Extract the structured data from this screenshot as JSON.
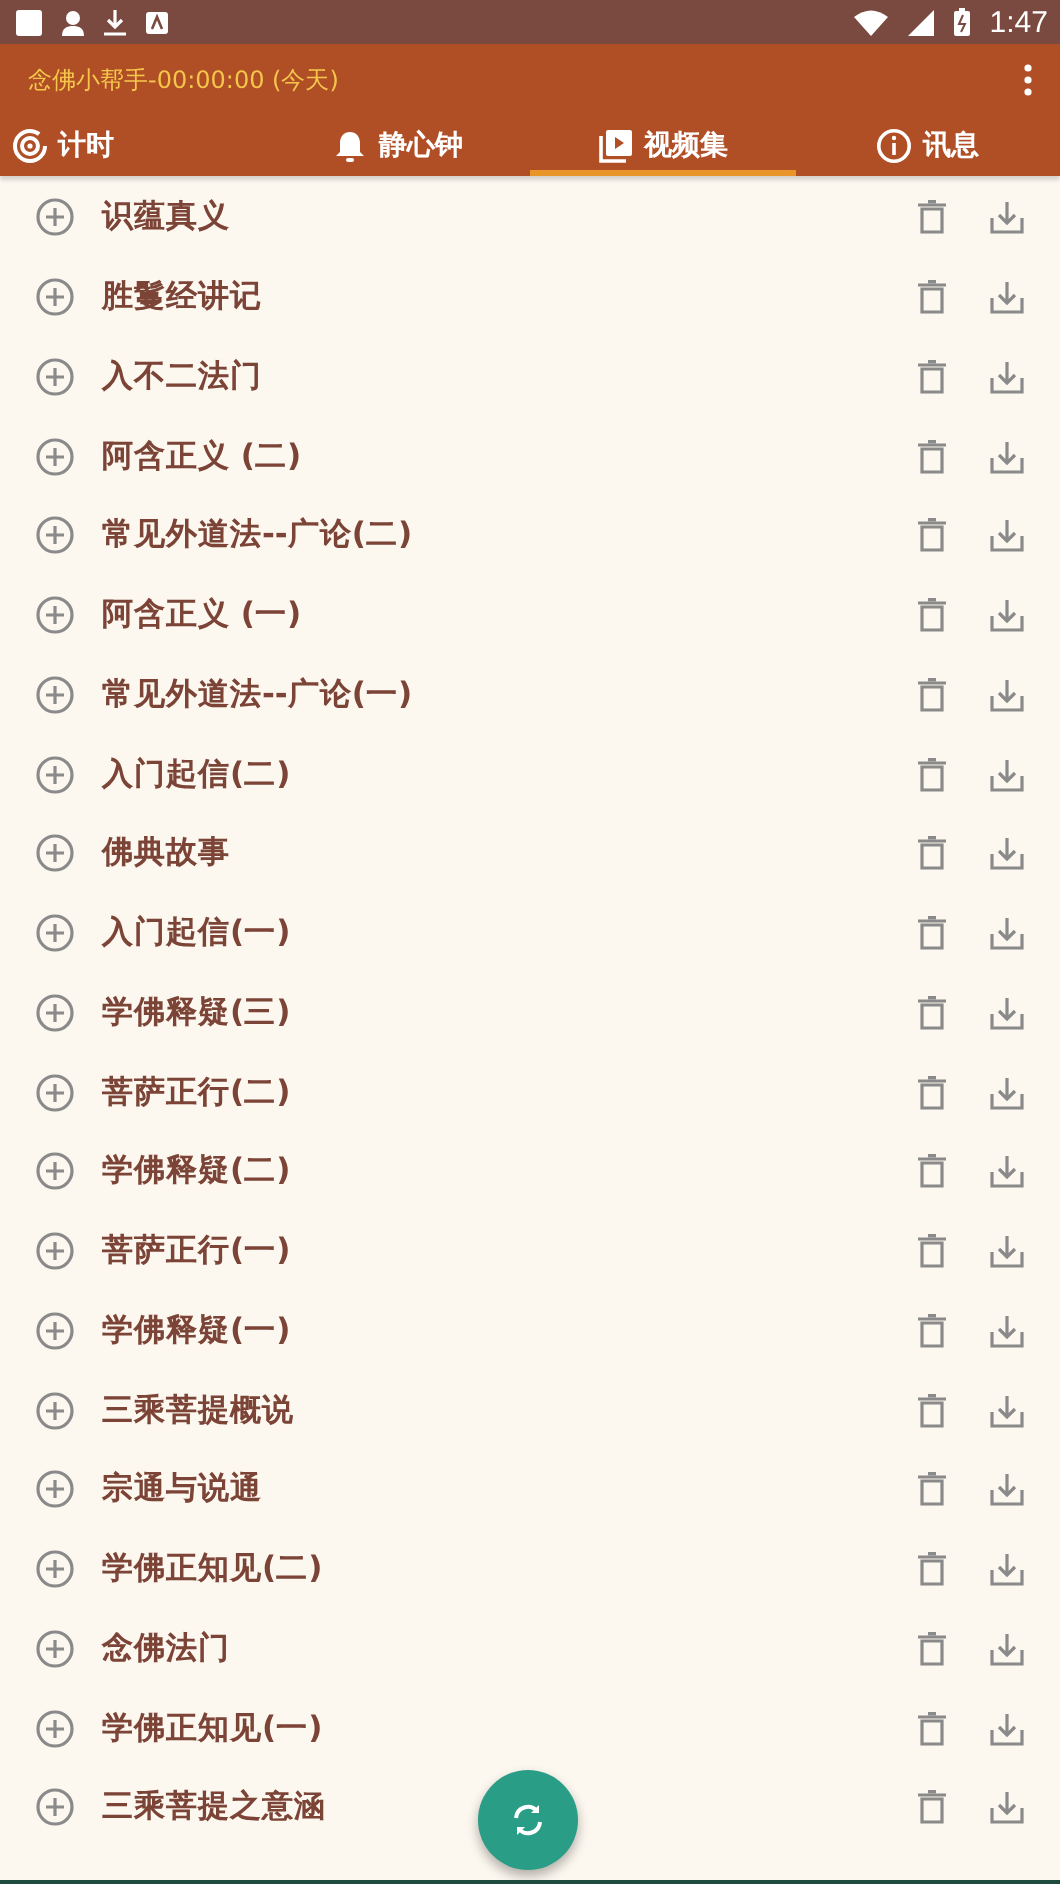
{
  "status_bar": {
    "time": "1:47"
  },
  "app_bar": {
    "title": "念佛小帮手-00:00:00 (今天)"
  },
  "tabs": [
    {
      "label": "计时",
      "kind": "timer",
      "selected": false
    },
    {
      "label": "静心钟",
      "kind": "bell",
      "selected": false
    },
    {
      "label": "视频集",
      "kind": "video",
      "selected": true
    },
    {
      "label": "讯息",
      "kind": "info",
      "selected": false
    }
  ],
  "items": [
    {
      "title": "识蕴真义"
    },
    {
      "title": "胜鬘经讲记"
    },
    {
      "title": "入不二法门"
    },
    {
      "title": "阿含正义 (二)"
    },
    {
      "title": "常见外道法--广论(二)"
    },
    {
      "title": "阿含正义 (一)"
    },
    {
      "title": "常见外道法--广论(一)"
    },
    {
      "title": "入门起信(二)"
    },
    {
      "title": "佛典故事"
    },
    {
      "title": "入门起信(一)"
    },
    {
      "title": "学佛释疑(三)"
    },
    {
      "title": "菩萨正行(二)"
    },
    {
      "title": "学佛释疑(二)"
    },
    {
      "title": "菩萨正行(一)"
    },
    {
      "title": "学佛释疑(一)"
    },
    {
      "title": "三乘菩提概说"
    },
    {
      "title": "宗通与说通"
    },
    {
      "title": "学佛正知见(二)"
    },
    {
      "title": "念佛法门"
    },
    {
      "title": "学佛正知见(一)"
    },
    {
      "title": "三乘菩提之意涵"
    }
  ]
}
